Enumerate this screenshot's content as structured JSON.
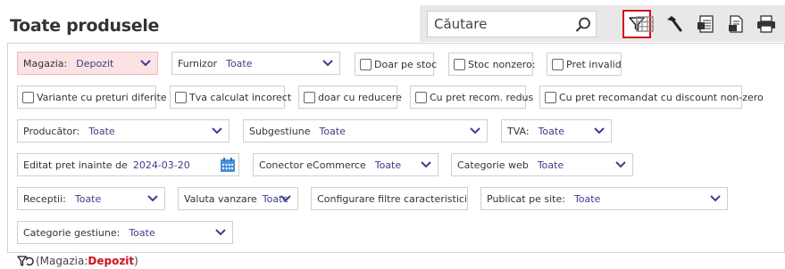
{
  "page_title": "Toate produsele",
  "search": {
    "placeholder": "Căutare"
  },
  "toolbar_icons": [
    "filter-icon",
    "grid-icon",
    "hammer-icon",
    "spreadsheet-icon",
    "document-icon",
    "print-icon"
  ],
  "filters": {
    "magazia": {
      "label": "Magazia:",
      "value": "Depozit"
    },
    "furnizor": {
      "label": "Furnizor",
      "value": "Toate"
    },
    "doar_pe_stoc": "Doar pe stoc",
    "stoc_nonzero": "Stoc nonzero:",
    "pret_invalid": "Pret invalid",
    "variante": "Variante cu preturi diferite",
    "tva_calculat": "Tva calculat incorect",
    "doar_reducere": "doar cu reducere",
    "cu_pret_recom": "Cu pret recom. redus",
    "cu_pret_discount": "Cu pret recomandat cu discount non-zero",
    "producator": {
      "label": "Producător:",
      "value": "Toate"
    },
    "subgestiune": {
      "label": "Subgestiune",
      "value": "Toate"
    },
    "tva": {
      "label": "TVA:",
      "value": "Toate"
    },
    "editat": {
      "label": "Editat pret inainte de",
      "value": "2024-03-20"
    },
    "conector": {
      "label": "Conector eCommerce",
      "value": "Toate"
    },
    "categorie_web": {
      "label": "Categorie web",
      "value": "Toate"
    },
    "receptii": {
      "label": "Receptii:",
      "value": "Toate"
    },
    "valuta": {
      "label": "Valuta vanzare",
      "value": "Toate"
    },
    "configurare": "Configurare filtre caracteristici",
    "publicat": {
      "label": "Publicat pe site:",
      "value": "Toate"
    },
    "categorie_gestiune": {
      "label": "Categorie gestiune:",
      "value": "Toate"
    }
  },
  "footer": {
    "prefix": "(Magazia: ",
    "value": "Depozit",
    "suffix": ")"
  },
  "colors": {
    "accent_red": "#d0121b",
    "value_blue": "#3d3d8f",
    "highlight_bg": "#fbe3e4",
    "toolbar_bg": "#e8e8e8"
  }
}
